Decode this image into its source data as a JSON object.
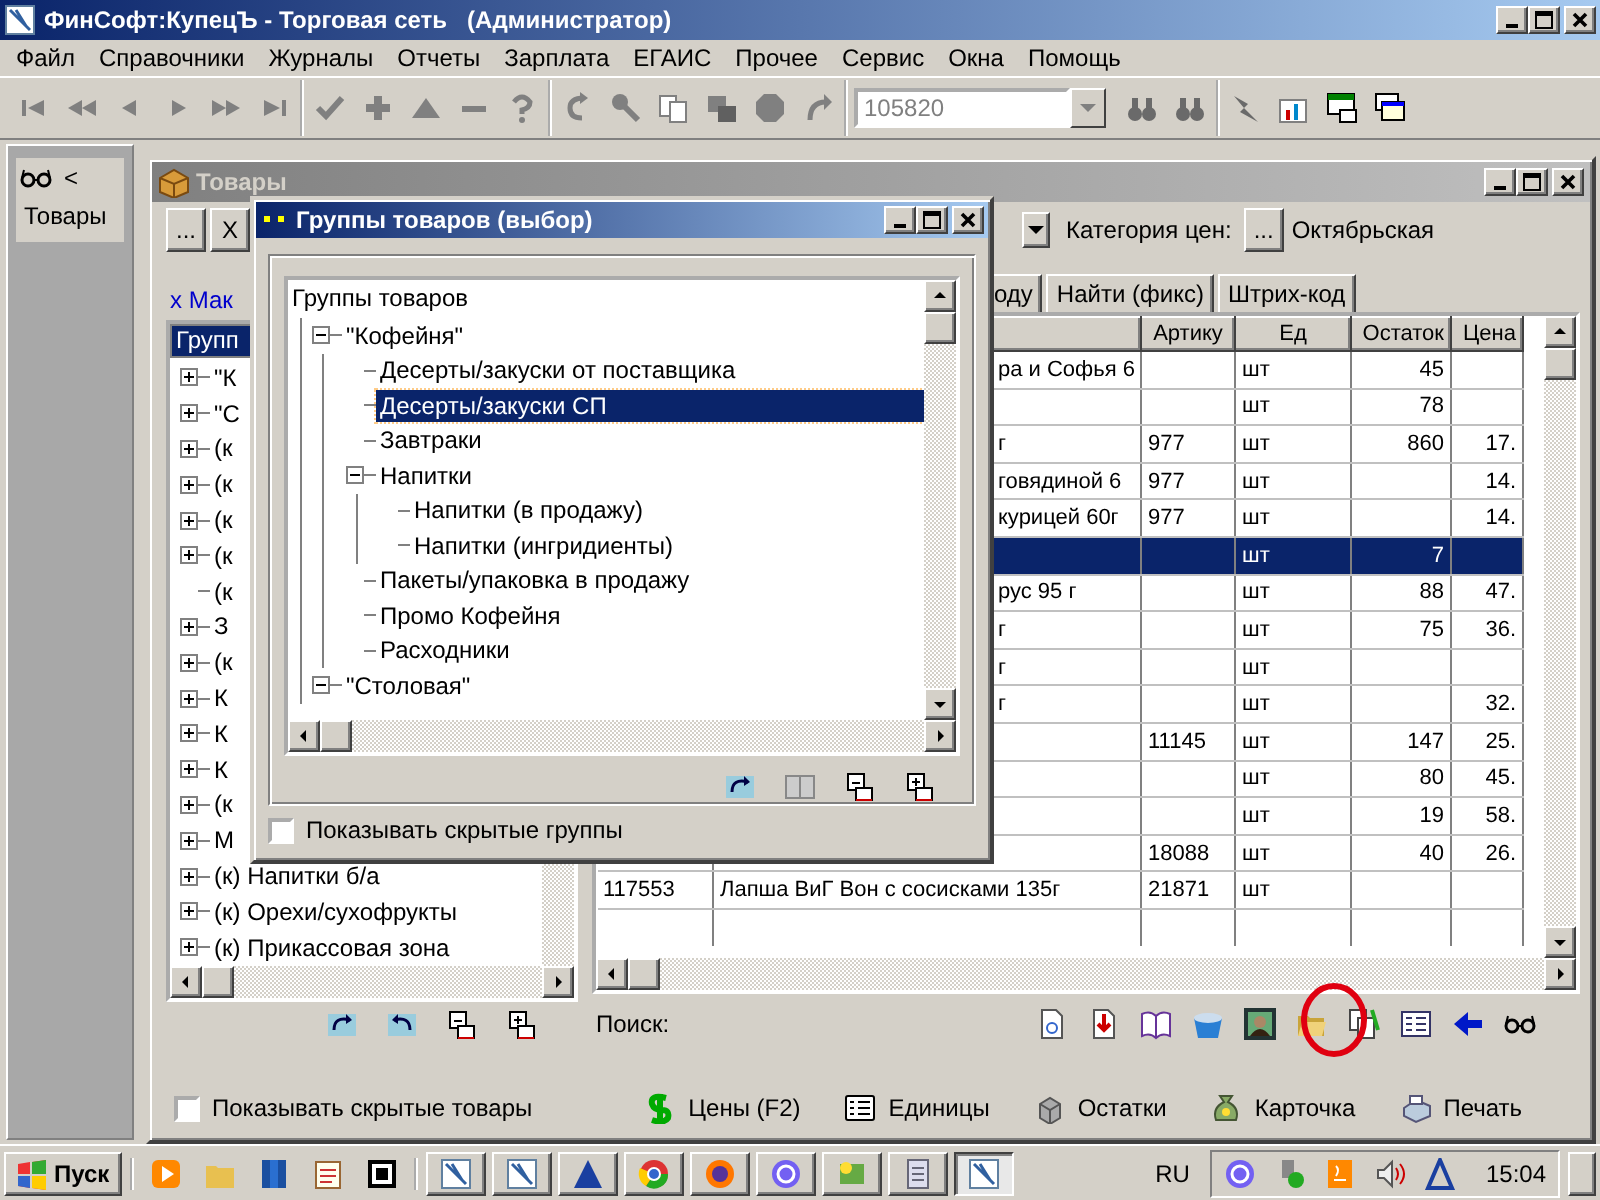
{
  "window": {
    "title": "ФинСофт:КупецЪ - Торговая сеть   (Администратор)"
  },
  "menu": [
    "Файл",
    "Справочники",
    "Журналы",
    "Отчеты",
    "Зарплата",
    "ЕГАИС",
    "Прочее",
    "Сервис",
    "Окна",
    "Помощь"
  ],
  "toolbar": {
    "search_value": "105820"
  },
  "side_panel": {
    "collapse": "<",
    "label": "Товары"
  },
  "goods_window": {
    "title": "Товары",
    "top_buttons": [
      "...",
      "X"
    ],
    "price_category_label": "Категория цен:",
    "price_category_button": "...",
    "price_category": "Октябрьская",
    "filter": "x Мак",
    "groups_header": "Групп",
    "groups": [
      {
        "label": "\"К",
        "expandable": true,
        "expanded": false,
        "selected": false
      },
      {
        "label": "\"С",
        "expandable": true,
        "expanded": false,
        "selected": false
      },
      {
        "label": "(к",
        "expandable": true,
        "expanded": false,
        "selected": false
      },
      {
        "label": "(к",
        "expandable": true,
        "expanded": false,
        "selected": false
      },
      {
        "label": "(к",
        "expandable": true,
        "expanded": false,
        "selected": false
      },
      {
        "label": "(к",
        "expandable": true,
        "expanded": false,
        "selected": false
      },
      {
        "label": "(к",
        "expandable": false,
        "selected": false
      },
      {
        "label": "З",
        "expandable": true,
        "expanded": false,
        "selected": false
      },
      {
        "label": "(к",
        "expandable": true,
        "expanded": false,
        "selected": false
      },
      {
        "label": "К",
        "expandable": true,
        "expanded": false,
        "selected": false
      },
      {
        "label": "К",
        "expandable": true,
        "expanded": false,
        "selected": false
      },
      {
        "label": "К",
        "expandable": true,
        "expanded": false,
        "selected": false
      },
      {
        "label": "(к",
        "expandable": true,
        "expanded": false,
        "selected": false
      },
      {
        "label": "М",
        "expandable": true,
        "expanded": false,
        "selected": false
      },
      {
        "label": "(к) Напитки б/а",
        "expandable": true,
        "expanded": false,
        "selected": false
      },
      {
        "label": "(к) Орехи/сухофрукты",
        "expandable": true,
        "expanded": false,
        "selected": false
      },
      {
        "label": "(к) Прикассовая зона",
        "expandable": true,
        "expanded": false,
        "selected": false
      }
    ],
    "tabs": [
      {
        "label": "оду",
        "selected": false
      },
      {
        "label": "Найти (фикс)",
        "selected": false
      },
      {
        "label": "Штрих-код",
        "selected": false
      }
    ],
    "table": {
      "columns": [
        "Артику",
        "Ед",
        "Остаток",
        "Цена"
      ],
      "rows": [
        {
          "name": "ра и Софья 6",
          "unit": "шт",
          "stock": "45",
          "selected": false
        },
        {
          "unit": "шт",
          "stock": "78",
          "selected": false
        },
        {
          "name": "г",
          "article": "977",
          "unit": "шт",
          "stock": "860",
          "price": "17.",
          "selected": false
        },
        {
          "name": "говядиной 6",
          "article": "977",
          "unit": "шт",
          "price": "14.",
          "selected": false
        },
        {
          "name": "курицей 60г",
          "article": "977",
          "unit": "шт",
          "price": "14.",
          "selected": false
        },
        {
          "unit": "шт",
          "stock": "7",
          "selected": true
        },
        {
          "name": "рус 95 г",
          "unit": "шт",
          "stock": "88",
          "price": "47.",
          "selected": false
        },
        {
          "name": "г",
          "unit": "шт",
          "stock": "75",
          "price": "36.",
          "selected": false
        },
        {
          "name": "г",
          "unit": "шт",
          "selected": false
        },
        {
          "name": "г",
          "unit": "шт",
          "price": "32.",
          "selected": false
        },
        {
          "article": "11145",
          "unit": "шт",
          "stock": "147",
          "price": "25.",
          "selected": false
        },
        {
          "unit": "шт",
          "stock": "80",
          "price": "45.",
          "selected": false
        },
        {
          "unit": "шт",
          "stock": "19",
          "price": "58.",
          "selected": false
        },
        {
          "article": "18088",
          "unit": "шт",
          "stock": "40",
          "price": "26.",
          "selected": false
        },
        {
          "code": "117553",
          "name": "Лапша ВиГ Вон с сосисками 135г",
          "article": "21871",
          "unit": "шт",
          "selected": false
        }
      ]
    },
    "search_label": "Поиск:",
    "show_hidden": {
      "label": "Показывать скрытые товары",
      "checked": false
    },
    "actions": [
      "Цены (F2)",
      "Единицы",
      "Остатки",
      "Карточка",
      "Печать"
    ]
  },
  "dialog": {
    "title": "Группы товаров (выбор)",
    "root": "Группы товаров",
    "groups": [
      {
        "label": "\"Кофейня\"",
        "expandable": true,
        "expanded": true,
        "selected": false,
        "children": [
          {
            "label": "Десерты/закуски от поставщика",
            "expandable": false,
            "selected": false
          },
          {
            "label": "Десерты/закуски СП",
            "expandable": false,
            "selected": true
          },
          {
            "label": "Завтраки",
            "expandable": false,
            "selected": false
          },
          {
            "label": "Напитки",
            "expandable": true,
            "expanded": true,
            "selected": false,
            "children": [
              {
                "label": "Напитки (в продажу)",
                "expandable": false,
                "selected": false
              },
              {
                "label": "Напитки (ингридиенты)",
                "expandable": false,
                "selected": false
              }
            ]
          },
          {
            "label": "Пакеты/упаковка в продажу",
            "expandable": false,
            "selected": false
          },
          {
            "label": "Промо Кофейня",
            "expandable": false,
            "selected": false
          },
          {
            "label": "Расходники",
            "expandable": false,
            "selected": false
          }
        ]
      },
      {
        "label": "\"Столовая\"",
        "expandable": true,
        "expanded": true,
        "selected": false
      }
    ],
    "show_hidden": {
      "label": "Показывать скрытые группы",
      "checked": false
    }
  },
  "taskbar": {
    "start": "Пуск",
    "language": "RU",
    "clock": "15:04"
  }
}
